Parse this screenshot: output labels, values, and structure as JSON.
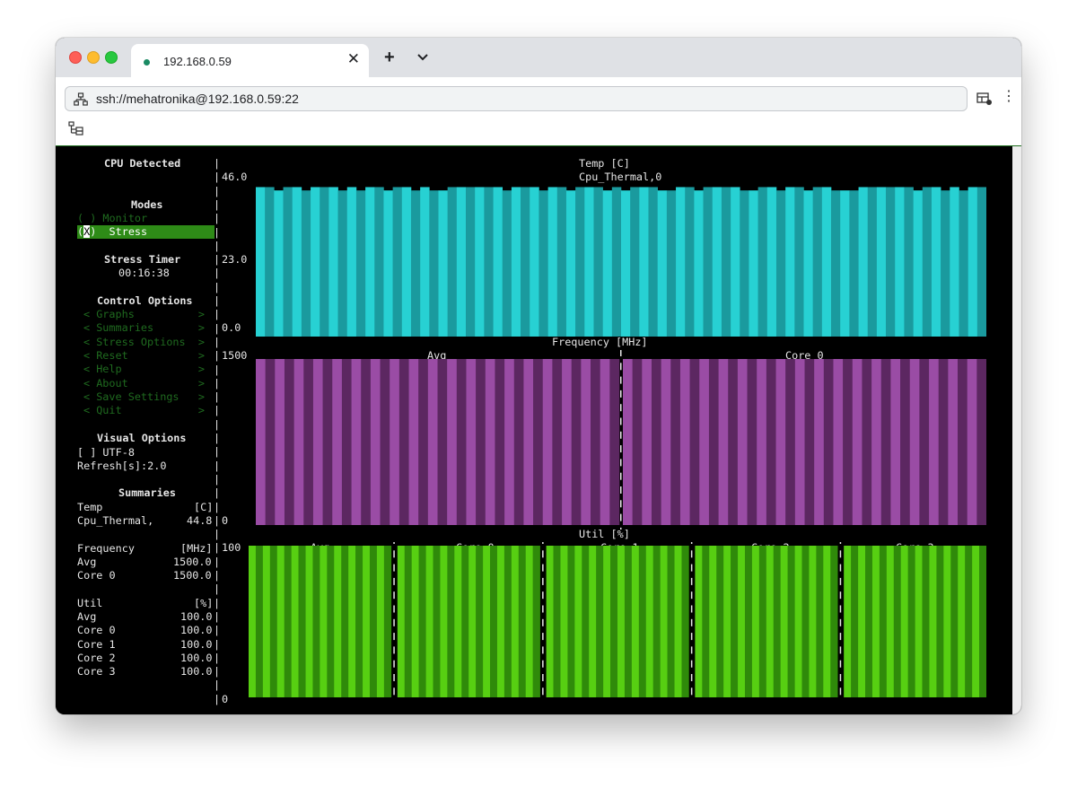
{
  "browser": {
    "tab_title": "192.168.0.59",
    "address": "ssh://mehatronika@192.168.0.59:22",
    "icons": [
      "network-icon",
      "close-icon",
      "plus-icon",
      "chevron-down-icon",
      "split-view-icon",
      "more-vert-icon",
      "tree-view-icon"
    ]
  },
  "sidebar": {
    "cpu_detected": "CPU Detected",
    "modes_title": "Modes",
    "mode_monitor": "( ) Monitor",
    "mode_stress_open": "(",
    "mode_stress_x": "X",
    "mode_stress_rest": ")  Stress",
    "stress_timer_title": "Stress Timer",
    "stress_timer_value": "00:16:38",
    "control_title": "Control Options",
    "controls": [
      "< Graphs          >",
      "< Summaries       >",
      "< Stress Options  >",
      "< Reset           >",
      "< Help            >",
      "< About           >",
      "< Save Settings   >",
      "< Quit            >"
    ],
    "visual_title": "Visual Options",
    "utf8": "[ ] UTF-8",
    "refresh": "Refresh[s]:2.0",
    "summaries_title": "Summaries",
    "temp_label": "Temp",
    "temp_unit": "[C]",
    "temp_sensor": "Cpu_Thermal,",
    "temp_value": "44.8",
    "freq_label": "Frequency",
    "freq_unit": "[MHz]",
    "freq_rows": [
      {
        "name": "Avg",
        "value": "1500.0"
      },
      {
        "name": "Core 0",
        "value": "1500.0"
      }
    ],
    "util_label": "Util",
    "util_unit": "[%]",
    "util_rows": [
      {
        "name": "Avg",
        "value": "100.0"
      },
      {
        "name": "Core 0",
        "value": "100.0"
      },
      {
        "name": "Core 1",
        "value": "100.0"
      },
      {
        "name": "Core 2",
        "value": "100.0"
      },
      {
        "name": "Core 3",
        "value": "100.0"
      }
    ]
  },
  "graphs": {
    "temp_title": "Temp [C]",
    "temp_series": "Cpu_Thermal,0",
    "temp_axis": [
      "46.0",
      "23.0",
      "0.0"
    ],
    "freq_title": "Frequency [MHz]",
    "freq_axis_top": "1500",
    "freq_axis_bottom": "0",
    "freq_panels": [
      "Avg",
      "Core 0"
    ],
    "util_title": "Util [%]",
    "util_axis_top": "100",
    "util_axis_bottom": "0",
    "util_panels": [
      "Avg",
      "Core 0",
      "Core 1",
      "Core 2",
      "Core 3"
    ],
    "colors": {
      "temp_light": "#27d1d3",
      "temp_dark": "#1a9a9e",
      "freq_light": "#9a4ca5",
      "freq_dark": "#5c2761",
      "util_light": "#57cf12",
      "util_dark": "#2f8a0a"
    }
  },
  "chart_data": [
    {
      "type": "bar",
      "title": "Temp [C]",
      "series": [
        {
          "name": "Cpu_Thermal,0",
          "values": [
            44.8,
            44.8,
            43.8,
            44.8,
            44.8,
            43.8,
            44.8,
            44.8,
            44.8,
            43.8,
            44.8,
            43.8,
            44.8,
            44.8,
            43.8,
            44.8,
            44.8,
            43.8,
            44.8,
            43.8,
            43.8,
            44.8,
            44.8,
            44.8,
            44.8,
            44.8,
            44.8,
            43.8,
            44.8,
            44.8,
            44.8,
            43.8,
            44.8,
            44.8,
            43.8,
            44.8,
            44.8,
            44.8,
            43.8,
            44.8,
            43.8,
            44.8,
            44.8,
            44.8,
            43.8,
            43.8,
            44.8,
            44.8,
            43.8,
            44.8,
            44.8,
            44.8,
            44.8,
            43.8,
            43.8,
            44.8,
            44.8,
            43.8,
            44.8,
            44.8,
            43.8,
            44.8,
            44.8,
            43.8,
            43.8,
            43.8,
            44.8,
            44.8,
            44.8,
            44.8,
            44.8,
            44.8,
            43.8,
            44.8,
            44.8,
            43.8,
            44.8,
            43.8,
            44.8,
            44.8
          ]
        }
      ],
      "ylim": [
        0,
        46
      ]
    },
    {
      "type": "bar",
      "title": "Frequency [MHz]",
      "series": [
        {
          "name": "Avg",
          "values": [
            1500
          ]
        },
        {
          "name": "Core 0",
          "values": [
            1500
          ]
        }
      ],
      "ylim": [
        0,
        1500
      ]
    },
    {
      "type": "bar",
      "title": "Util [%]",
      "series": [
        {
          "name": "Avg",
          "values": [
            100
          ]
        },
        {
          "name": "Core 0",
          "values": [
            100
          ]
        },
        {
          "name": "Core 1",
          "values": [
            100
          ]
        },
        {
          "name": "Core 2",
          "values": [
            100
          ]
        },
        {
          "name": "Core 3",
          "values": [
            100
          ]
        }
      ],
      "ylim": [
        0,
        100
      ]
    }
  ]
}
